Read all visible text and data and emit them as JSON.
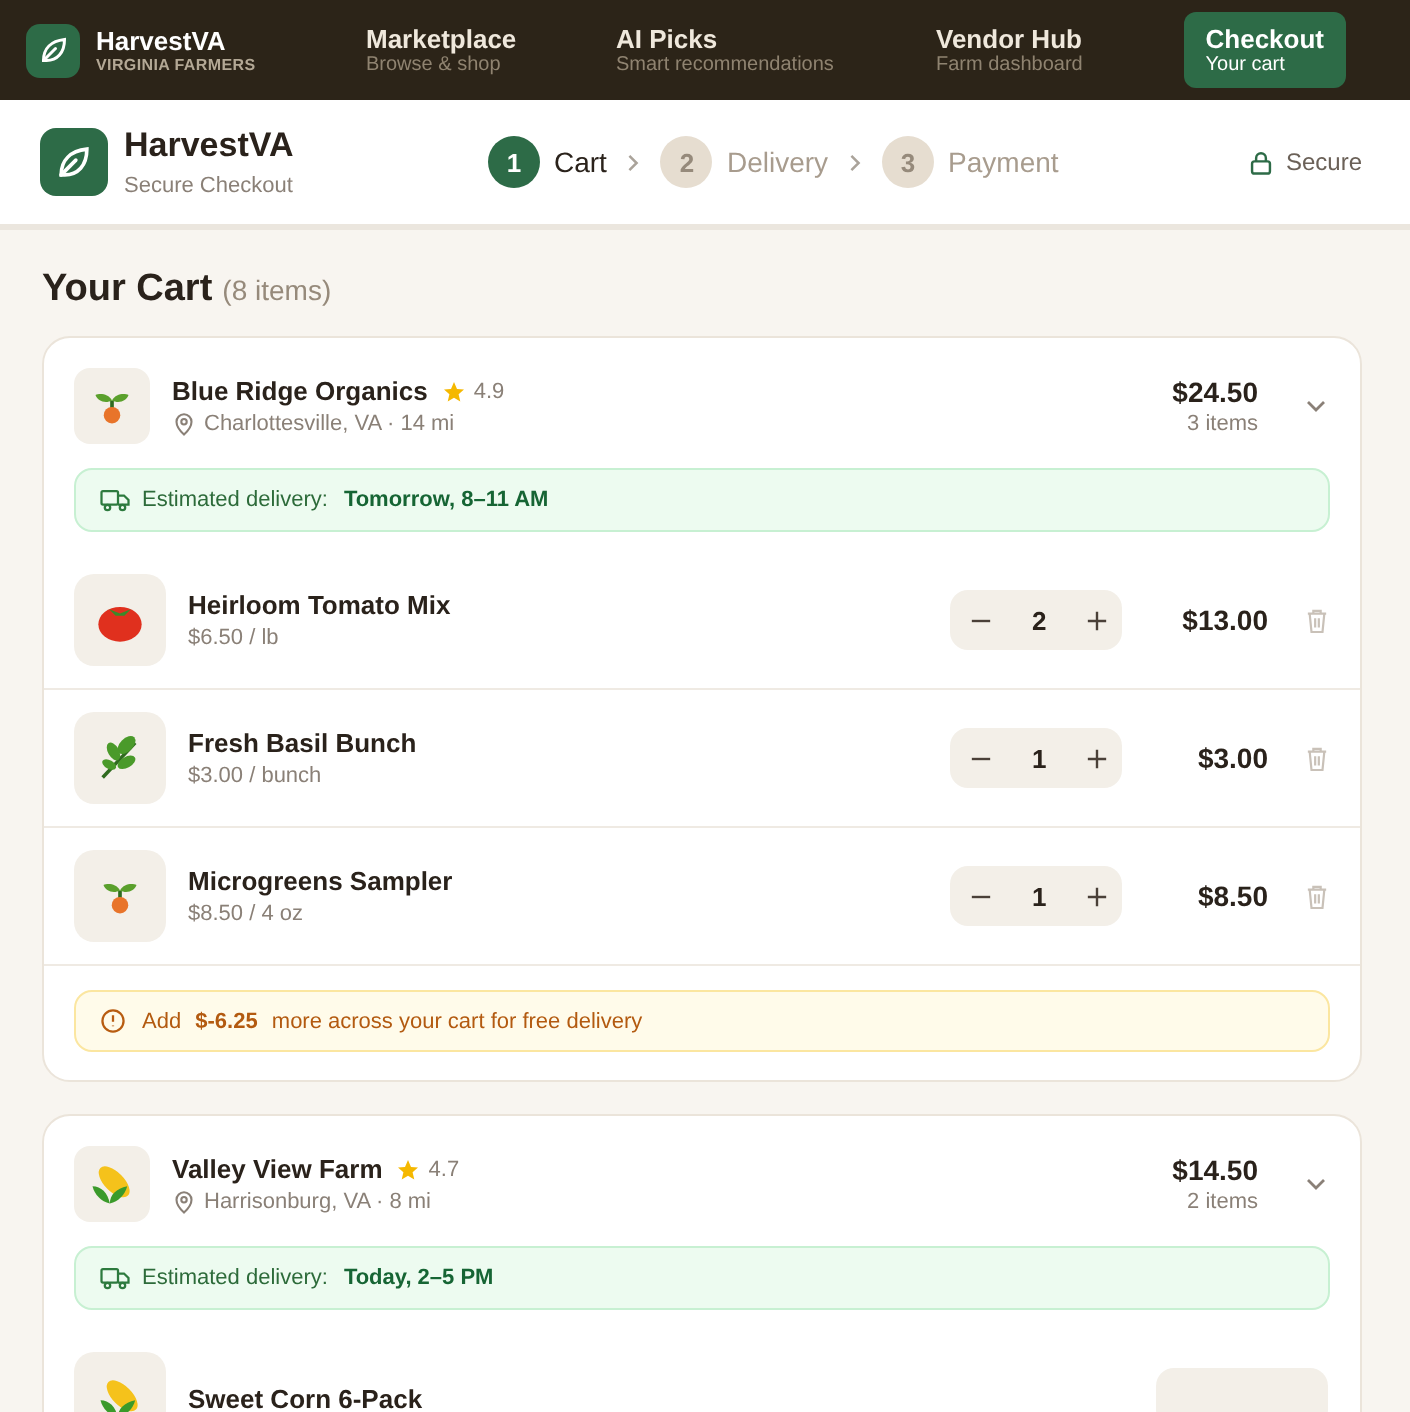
{
  "topnav": {
    "brand": "HarvestVA",
    "tagline": "VIRGINIA FARMERS",
    "items": [
      {
        "label": "Marketplace",
        "sub": "Browse & shop",
        "selected": false
      },
      {
        "label": "AI Picks",
        "sub": "Smart recommendations",
        "selected": false
      },
      {
        "label": "Vendor Hub",
        "sub": "Farm dashboard",
        "selected": false
      },
      {
        "label": "Checkout",
        "sub": "Your cart",
        "selected": true
      }
    ]
  },
  "header": {
    "brand": "HarvestVA",
    "subtitle": "Secure Checkout",
    "secure": "Secure",
    "steps": [
      {
        "number": "1",
        "label": "Cart",
        "selected": true
      },
      {
        "number": "2",
        "label": "Delivery",
        "selected": false
      },
      {
        "number": "3",
        "label": "Payment",
        "selected": false
      }
    ]
  },
  "cart": {
    "title": "Your Cart",
    "count": "(8 items)",
    "vendors": [
      {
        "name": "Blue Ridge Organics",
        "kind": "sprout",
        "rating": "4.9",
        "location": "Charlottesville, VA · 14 mi",
        "total": "$24.50",
        "items_count": "3 items",
        "delivery_label": "Estimated delivery:",
        "delivery_time": "Tomorrow, 8–11 AM",
        "notice": "Add **$-6.25** more across your cart for free delivery",
        "items": [
          {
            "name": "Heirloom Tomato Mix",
            "kind": "tomato",
            "unit": "$6.50 / lb",
            "qty": "2",
            "price": "$13.00"
          },
          {
            "name": "Fresh Basil Bunch",
            "kind": "basil",
            "unit": "$3.00 / bunch",
            "qty": "1",
            "price": "$3.00"
          },
          {
            "name": "Microgreens Sampler",
            "kind": "sprout",
            "unit": "$8.50 / 4 oz",
            "qty": "1",
            "price": "$8.50"
          }
        ]
      },
      {
        "name": "Valley View Farm",
        "kind": "corn",
        "rating": "4.7",
        "location": "Harrisonburg, VA · 8 mi",
        "total": "$14.50",
        "items_count": "2 items",
        "delivery_label": "Estimated delivery:",
        "delivery_time": "Today, 2–5 PM",
        "items": [
          {
            "name": "Sweet Corn 6-Pack",
            "kind": "corn"
          }
        ]
      }
    ]
  }
}
